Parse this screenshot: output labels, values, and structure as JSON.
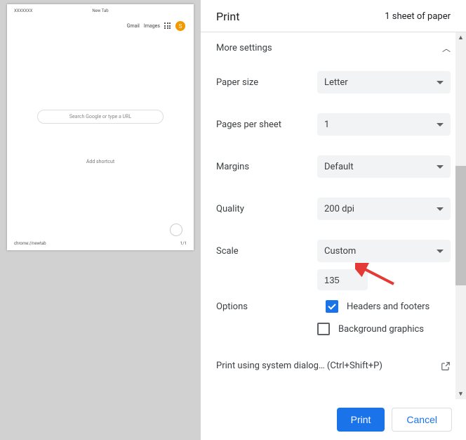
{
  "preview": {
    "header_left": "XXXXXXX",
    "header_center": "New Tab",
    "footer_left": "chrome://newtab",
    "footer_right": "1/1",
    "gmail": "Gmail",
    "images": "Images",
    "avatar_initial": "S",
    "search_placeholder": "Search Google or type a URL",
    "add_shortcut": "Add shortcut"
  },
  "header": {
    "title": "Print",
    "sheet_count": "1 sheet of paper"
  },
  "more_settings_label": "More settings",
  "settings": {
    "paper_size": {
      "label": "Paper size",
      "value": "Letter"
    },
    "pages_per_sheet": {
      "label": "Pages per sheet",
      "value": "1"
    },
    "margins": {
      "label": "Margins",
      "value": "Default"
    },
    "quality": {
      "label": "Quality",
      "value": "200 dpi"
    },
    "scale": {
      "label": "Scale",
      "value": "Custom",
      "custom_value": "135"
    },
    "options": {
      "label": "Options",
      "headers_footers": {
        "label": "Headers and footers",
        "checked": true
      },
      "background_graphics": {
        "label": "Background graphics",
        "checked": false
      }
    }
  },
  "system_dialog": {
    "text": "Print using system dialog…",
    "shortcut": "(Ctrl+Shift+P)"
  },
  "buttons": {
    "print": "Print",
    "cancel": "Cancel"
  }
}
